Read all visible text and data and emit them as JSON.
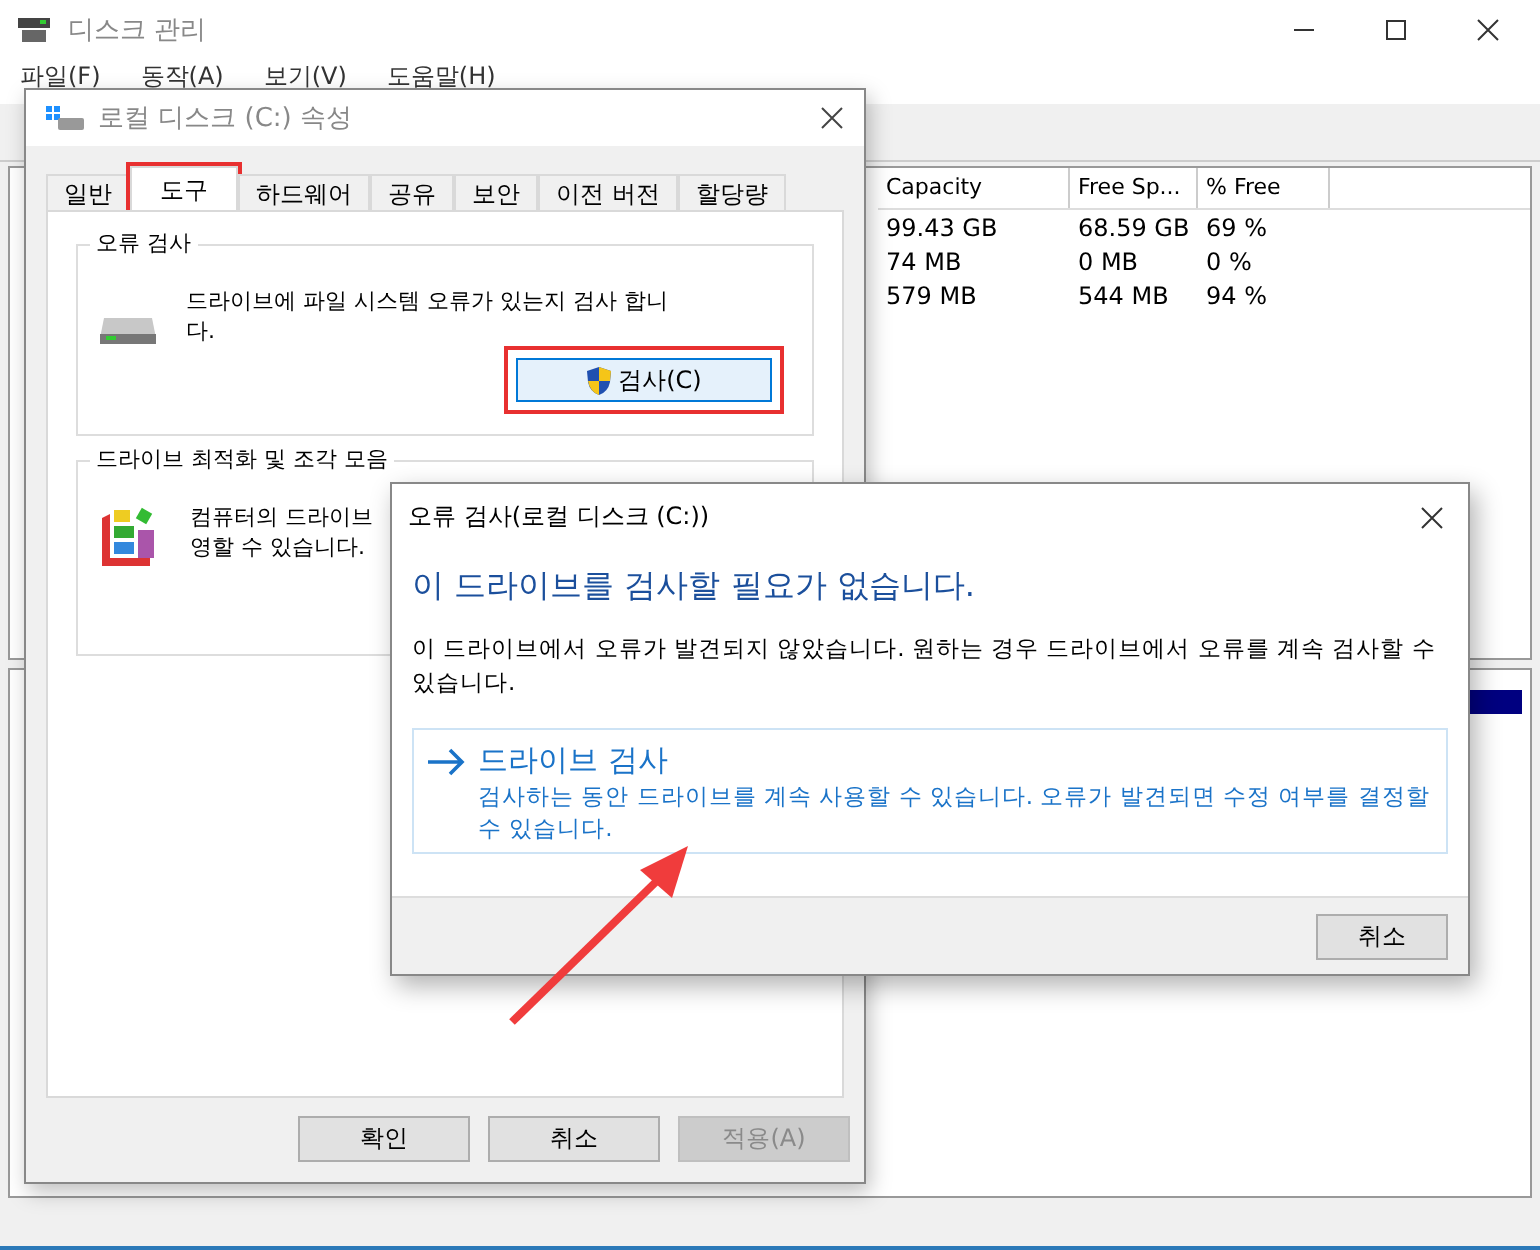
{
  "main_window": {
    "title": "디스크 관리",
    "menu": [
      "파일(F)",
      "동작(A)",
      "보기(V)",
      "도움말(H)"
    ],
    "table": {
      "columns": [
        "Capacity",
        "Free Sp...",
        "% Free"
      ],
      "rows": [
        [
          "99.43 GB",
          "68.59 GB",
          "69 %"
        ],
        [
          "74 MB",
          "0 MB",
          "0 %"
        ],
        [
          "579 MB",
          "544 MB",
          "94 %"
        ]
      ]
    }
  },
  "properties_dialog": {
    "title": "로컬 디스크 (C:) 속성",
    "tabs": [
      {
        "label": "일반",
        "selected": false,
        "highlighted": false
      },
      {
        "label": "도구",
        "selected": true,
        "highlighted": true
      },
      {
        "label": "하드웨어",
        "selected": false,
        "highlighted": false
      },
      {
        "label": "공유",
        "selected": false,
        "highlighted": false
      },
      {
        "label": "보안",
        "selected": false,
        "highlighted": false
      },
      {
        "label": "이전 버전",
        "selected": false,
        "highlighted": false
      },
      {
        "label": "할당량",
        "selected": false,
        "highlighted": false
      }
    ],
    "error_check": {
      "title": "오류 검사",
      "description": "드라이브에 파일 시스템 오류가 있는지 검사 합니다.",
      "button": {
        "label": "검사(C)",
        "highlighted": true
      }
    },
    "optimize": {
      "title": "드라이브 최적화 및 조각 모음",
      "description_lines": [
        "컴퓨터의 드라이브",
        "영할 수 있습니다."
      ]
    },
    "buttons": [
      {
        "label": "확인",
        "disabled": false
      },
      {
        "label": "취소",
        "disabled": false
      },
      {
        "label": "적용(A)",
        "disabled": true
      }
    ]
  },
  "error_dialog": {
    "title": "오류 검사(로컬 디스크 (C:))",
    "heading": "이 드라이브를 검사할 필요가 없습니다.",
    "body": "이 드라이브에서 오류가 발견되지 않았습니다. 원하는 경우 드라이브에서 오류를 계속 검사할 수 있습니다.",
    "option": {
      "label": "드라이브 검사",
      "description": "검사하는 동안 드라이브를 계속 사용할 수 있습니다. 오류가 발견되면 수정 여부를 결정할 수 있습니다."
    },
    "button": "취소"
  },
  "pointer_arrow": true
}
